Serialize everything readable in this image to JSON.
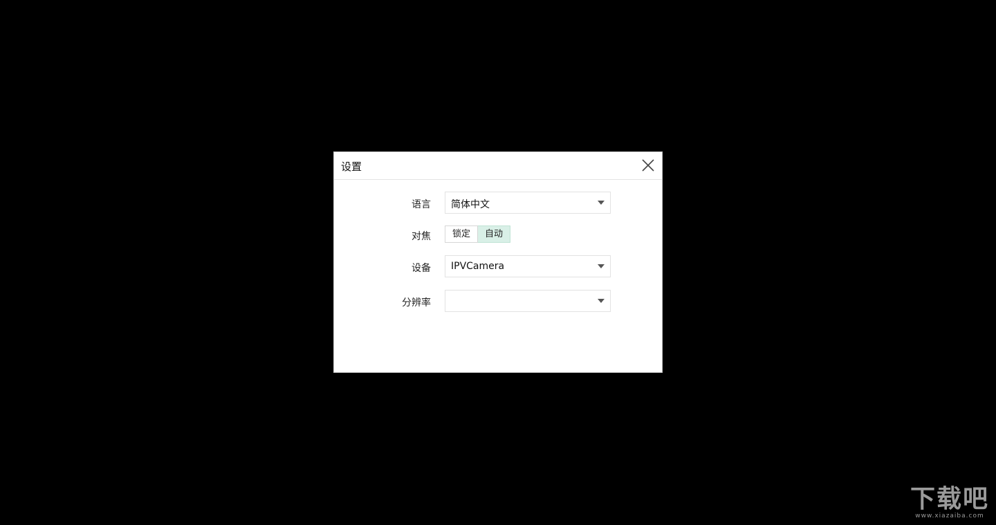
{
  "dialog": {
    "title": "设置",
    "close_icon": "close-icon",
    "language": {
      "label": "语言",
      "value": "简体中文"
    },
    "focus": {
      "label": "对焦",
      "options": [
        "锁定",
        "自动"
      ],
      "selected": "自动"
    },
    "device": {
      "label": "设备",
      "value": "IPVCamera"
    },
    "resolution": {
      "label": "分辨率",
      "value": ""
    }
  },
  "watermark": {
    "main": "下载吧",
    "sub": "www.xiazaiba.com"
  },
  "colors": {
    "background": "#000000",
    "active_segment": "#d9f0e7"
  }
}
